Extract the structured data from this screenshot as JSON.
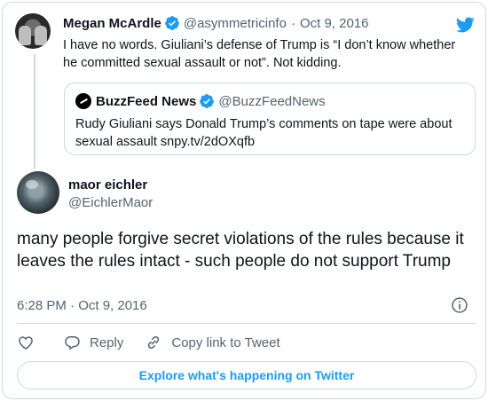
{
  "parent_tweet": {
    "name": "Megan McArdle",
    "handle": "@asymmetricinfo",
    "separator": "·",
    "date": "Oct 9, 2016",
    "text": "I have no words. Giuliani’s defense of Trump is “I don’t know whether he committed sexual assault or not”. Not kidding.",
    "quote": {
      "name": "BuzzFeed News",
      "handle": "@BuzzFeedNews",
      "text": "Rudy Giuliani says Donald Trump’s comments on tape were about sexual assault snpy.tv/2dOXqfb"
    }
  },
  "tweet": {
    "name": "maor eichler",
    "handle": "@EichlerMaor",
    "text": "many people forgive secret violations of the rules because it leaves the rules intact - such people do not support Trump",
    "timestamp": "6:28 PM · Oct 9, 2016"
  },
  "actions": {
    "reply_label": "Reply",
    "copy_label": "Copy link to Tweet"
  },
  "explore_label": "Explore what's happening on Twitter",
  "colors": {
    "accent": "#1d9bf0",
    "muted": "#536471",
    "border": "#cfd9de"
  }
}
